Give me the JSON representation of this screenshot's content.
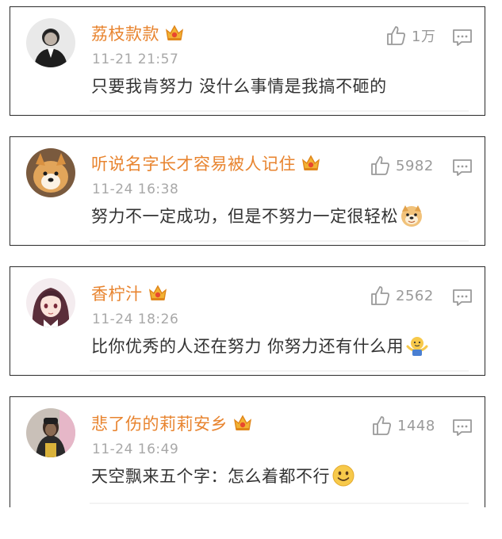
{
  "comments": [
    {
      "username": "荔枝款款",
      "timestamp": "11-21 21:57",
      "text": "只要我肯努力 没什么事情是我搞不砸的",
      "likes": "1万",
      "emoji": ""
    },
    {
      "username": "听说名字长才容易被人记住",
      "timestamp": "11-24 16:38",
      "text": "努力不一定成功，但是不努力一定很轻松",
      "likes": "5982",
      "emoji": "doge"
    },
    {
      "username": "香柠汁",
      "timestamp": "11-24 18:26",
      "text": "比你优秀的人还在努力 你努力还有什么用",
      "likes": "2562",
      "emoji": "shrug"
    },
    {
      "username": "悲了伤的莉莉安乡",
      "timestamp": "11-24 16:49",
      "text": "天空飘来五个字：怎么着都不行",
      "likes": "1448",
      "emoji": "smile"
    }
  ],
  "colors": {
    "username": "#e8842f",
    "timestamp": "#a8a8a8",
    "comment_text": "#333333",
    "meta_icon": "#9a9a9a",
    "border": "#2b2b2b"
  }
}
